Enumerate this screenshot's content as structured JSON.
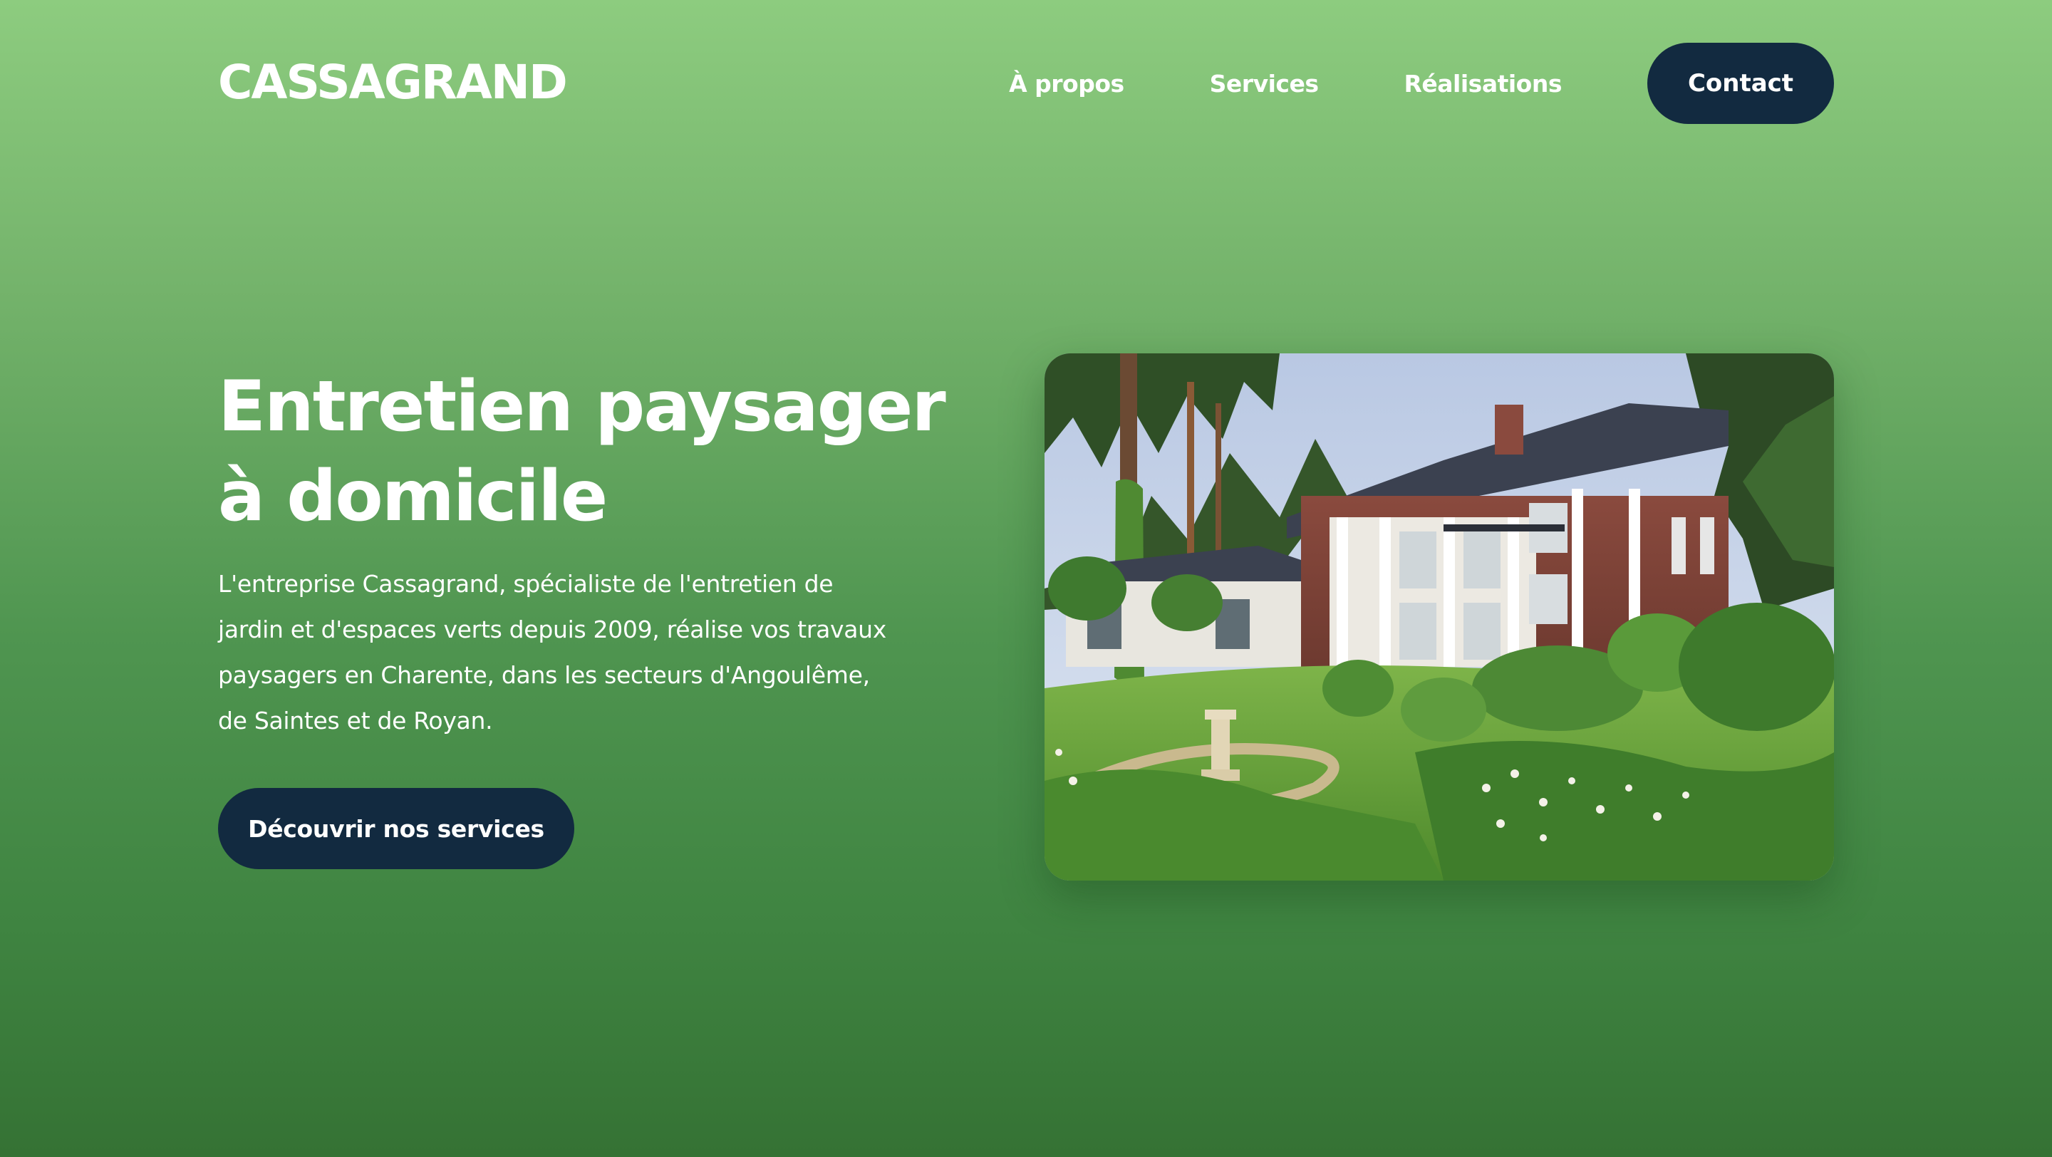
{
  "header": {
    "logo": "CASSAGRAND",
    "nav": [
      {
        "label": "À propos"
      },
      {
        "label": "Services"
      },
      {
        "label": "Réalisations"
      }
    ],
    "contact_label": "Contact"
  },
  "hero": {
    "title_line1": "Entretien paysager",
    "title_line2": "à domicile",
    "description": "L'entreprise Cassagrand, spécialiste de l'entretien de jardin et d'espaces verts depuis 2009, réalise vos travaux paysagers en Charente, dans les secteurs d'Angoulême, de Saintes et de Royan.",
    "cta_label": "Découvrir nos services"
  },
  "colors": {
    "button_bg": "#122a40",
    "gradient_top": "#8dcc7f",
    "gradient_bottom": "#357234"
  }
}
